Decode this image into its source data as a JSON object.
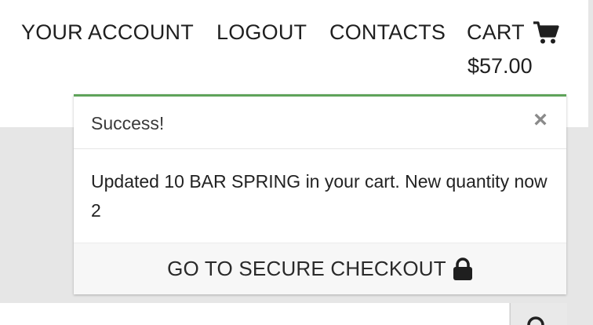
{
  "header": {
    "nav": {
      "your_account": "YOUR ACCOUNT",
      "logout": "LOGOUT",
      "contacts": "CONTACTS",
      "cart": "CART"
    },
    "cart_total": "$57.00",
    "cart_icon": "shopping-cart-icon"
  },
  "toast": {
    "title": "Success!",
    "close_symbol": "×",
    "message": "Updated 10 BAR SPRING in your cart. New quantity now 2",
    "checkout_label": "GO TO SECURE CHECKOUT",
    "checkout_icon": "lock-icon",
    "accent_color": "#5fa35a"
  },
  "search": {
    "placeholder": "",
    "icon": "search-icon"
  },
  "colors": {
    "page_background": "#e6e6e6",
    "header_background": "#ffffff",
    "text": "#1f1f1f"
  }
}
